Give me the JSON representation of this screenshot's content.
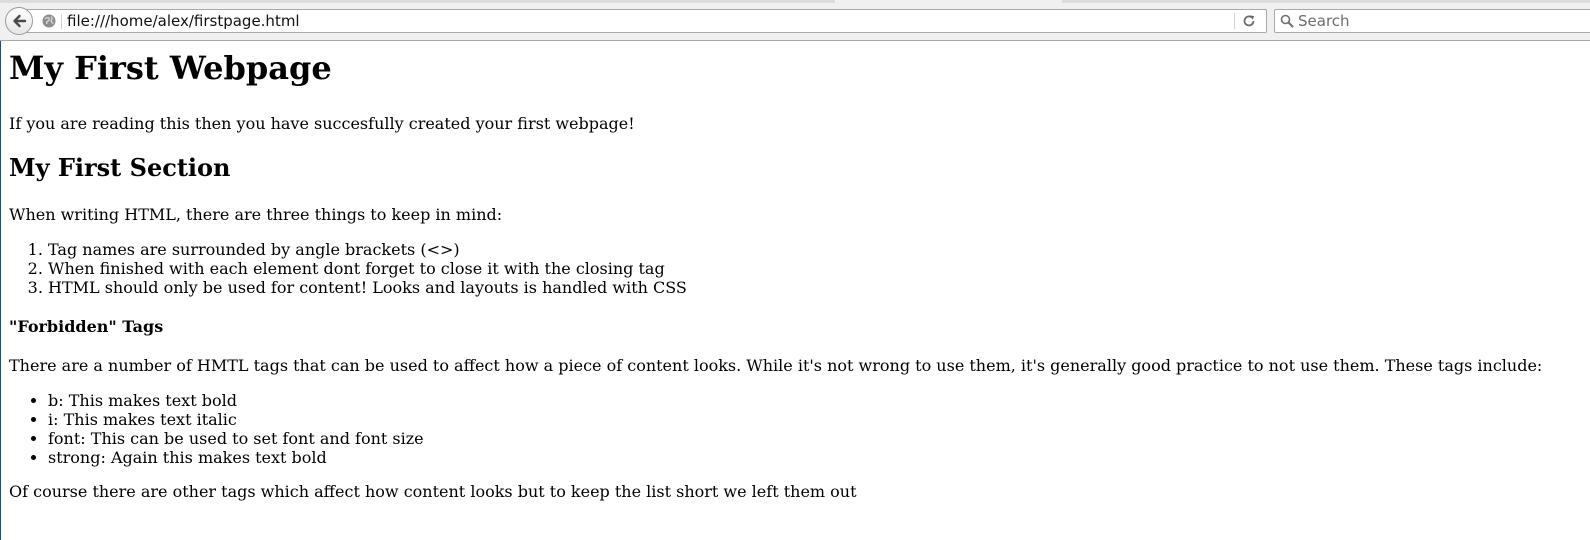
{
  "browser": {
    "url": "file:///home/alex/firstpage.html",
    "search_placeholder": "Search"
  },
  "page": {
    "h1": "My First Webpage",
    "intro": "If you are reading this then you have succesfully created your first webpage!",
    "section_title": "My First Section",
    "section_intro": "When writing HTML, there are three things to keep in mind:",
    "ordered_items": [
      "Tag names are surrounded by angle brackets (<>)",
      "When finished with each element dont forget to close it with the closing tag",
      "HTML should only be used for content! Looks and layouts is handled with CSS"
    ],
    "subsection_title": "\"Forbidden\" Tags",
    "subsection_intro": "There are a number of HMTL tags that can be used to affect how a piece of content looks. While it's not wrong to use them, it's generally good practice to not use them. These tags include:",
    "unordered_items": [
      "b: This makes text bold",
      "i: This makes text italic",
      "font: This can be used to set font and font size",
      "strong: Again this makes text bold"
    ],
    "closing": "Of course there are other tags which affect how content looks but to keep the list short we left them out"
  }
}
